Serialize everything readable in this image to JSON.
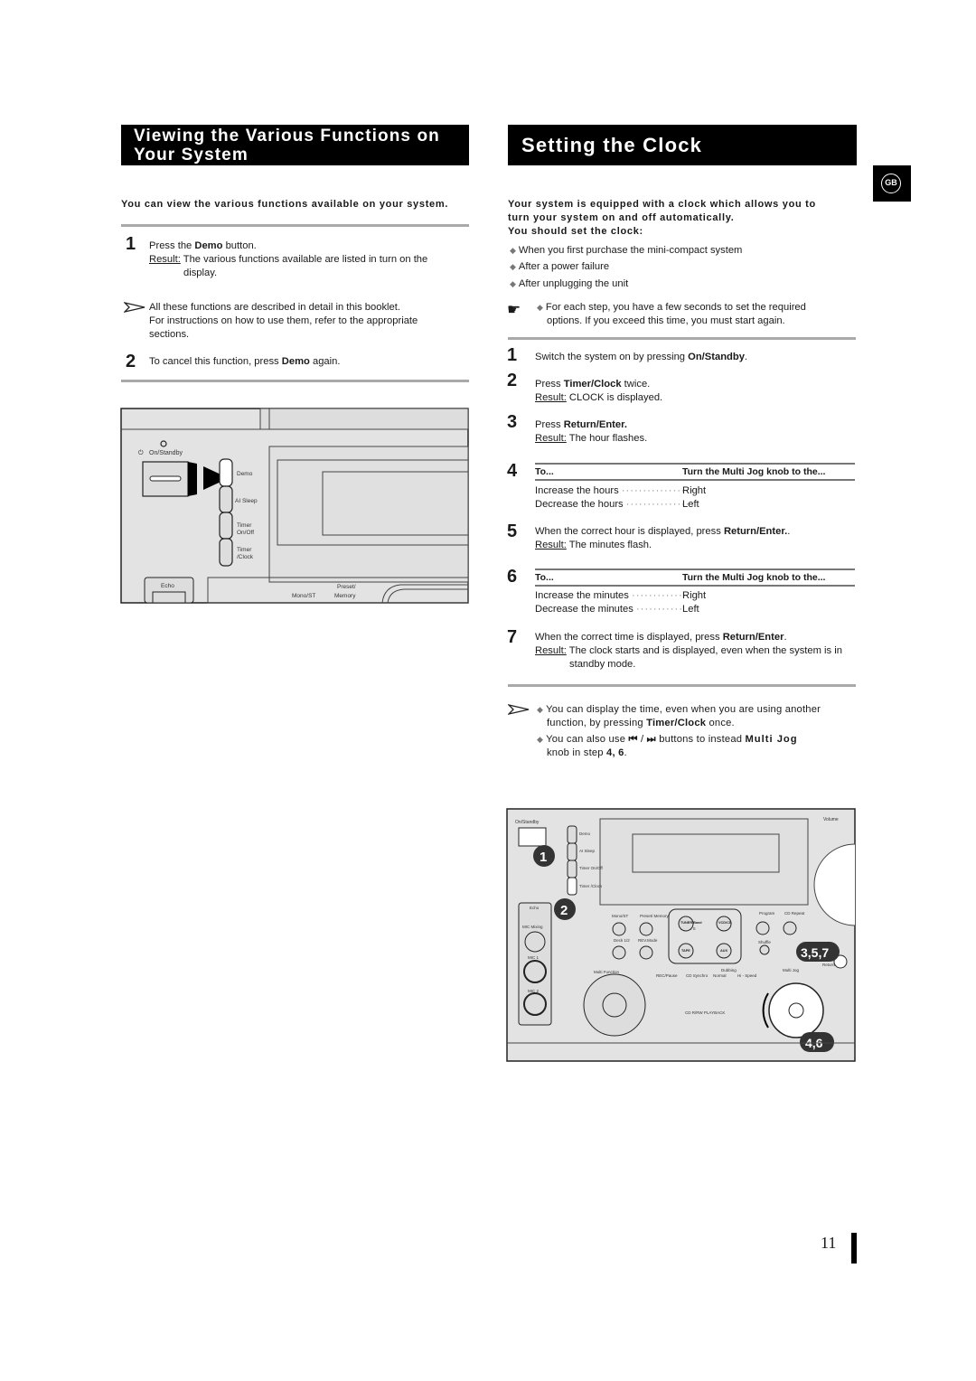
{
  "left": {
    "title_line1": "Viewing the Various Functions on",
    "title_line2": "Your System",
    "intro": "You can view the various functions available on your system.",
    "step1": {
      "num": "1",
      "pre": "Press the ",
      "bold": "Demo",
      "post": " button.",
      "result_label": "Result:",
      "result_text": " The various functions available are listed in turn on the",
      "result_cont": "display."
    },
    "note": {
      "line1": "All these functions are described in detail in this booklet.",
      "line2": "For instructions on how to use them, refer to the appropriate",
      "line3": "sections."
    },
    "step2": {
      "num": "2",
      "pre": "To cancel this function, press ",
      "bold": "Demo",
      "post": " again."
    },
    "figure": {
      "on_standby": "On/Standby",
      "demo": "Demo",
      "ai_sleep": "AI Sleep",
      "timer_onoff_1": "Timer",
      "timer_onoff_2": "On/Off",
      "timer_clock_1": "Timer",
      "timer_clock_2": "/Clock",
      "echo": "Echo",
      "mono_st": "Mono/ST",
      "preset_1": "Preset/",
      "preset_2": "Memory"
    }
  },
  "right": {
    "title": "Setting the Clock",
    "badge": "GB",
    "intro_line1": "Your system is equipped with a clock which allows you to",
    "intro_line2": "turn your system on and off automatically.",
    "intro_line3": "You should set the clock:",
    "bullets": [
      "When you first purchase the mini-compact system",
      "After a power failure",
      "After unplugging the unit"
    ],
    "hand_note": {
      "line1": "For each step, you have a few seconds to set the required",
      "line2": "options. If you exceed this time, you must start again."
    },
    "step1": {
      "num": "1",
      "pre": "Switch the system on by pressing ",
      "bold": "On/Standby",
      "post": "."
    },
    "step2": {
      "num": "2",
      "pre": "Press ",
      "bold": "Timer/Clock",
      "post": " twice.",
      "result_label": "Result:",
      "result_text": " CLOCK is displayed."
    },
    "step3": {
      "num": "3",
      "pre": "Press ",
      "bold": "Return/Enter.",
      "result_label": "Result:",
      "result_text": " The hour flashes."
    },
    "step4": {
      "num": "4",
      "col1": "To...",
      "col2": "Turn the Multi Jog knob to the...",
      "rows": [
        {
          "action": "Increase the hours",
          "dots": "··················",
          "dir": "Right"
        },
        {
          "action": "Decrease the hours",
          "dots": "················",
          "dir": "Left"
        }
      ]
    },
    "step5": {
      "num": "5",
      "pre": "When the correct hour is displayed, press ",
      "bold": "Return/Enter.",
      "post": ".",
      "result_label": "Result:",
      "result_text": " The minutes flash."
    },
    "step6": {
      "num": "6",
      "col1": "To...",
      "col2": "Turn the Multi Jog knob to the...",
      "rows": [
        {
          "action": "Increase the minutes",
          "dots": "·············",
          "dir": "Right"
        },
        {
          "action": "Decrease the minutes",
          "dots": "···········",
          "dir": "Left"
        }
      ]
    },
    "step7": {
      "num": "7",
      "pre": "When the correct time is displayed, press ",
      "bold": "Return/Enter",
      "post": ".",
      "result_label": "Result:",
      "result_text": " The clock starts and is displayed, even when the system is in",
      "result_cont": "standby mode."
    },
    "notes": {
      "n1_line1": "You can display the time, even when you are using another",
      "n1_pre": "function, by pressing ",
      "n1_bold": "Timer/Clock",
      "n1_post": " once.",
      "n2_pre": "You can also use ",
      "n2_prev": "⏮",
      "n2_sep": " / ",
      "n2_next": "⏭",
      "n2_mid": " buttons to instead ",
      "n2_bold": "Multi Jog",
      "n2_line2_pre": "knob in step ",
      "n2_steps": "4, 6",
      "n2_end": "."
    },
    "figure": {
      "callout_1": "1",
      "callout_2": "2",
      "callout_357": "3,5,7",
      "callout_46": "4,6",
      "volume": "Volume",
      "on_standby": "On/Standby",
      "demo": "Demo",
      "ai_sleep": "AI Sleep",
      "timer_onoff": "Timer On/Off",
      "timer_clock": "Timer /Clock",
      "echo": "Echo",
      "mic_mixing": "MIC Mixing",
      "mic1": "MIC 1",
      "mic2": "MIC 2",
      "mono_st": "Mono/ST",
      "preset": "Preset/ Memory",
      "tuner": "TUNER Band",
      "vcd": "VCD/CD",
      "dps": "D / P / S",
      "tape": "TAPE",
      "aux": "AUX",
      "program": "Program",
      "cd_repeat": "CD Repeat",
      "shuffle": "Shuffle",
      "deck": "Deck 1/2",
      "rev_mode": "REV.Mode",
      "rec_pause": "REC/Pause",
      "cd_synchro": "CD Synchro",
      "normal": "Normal",
      "hi_speed": "Hi - Speed",
      "dubbing": "Dubbing",
      "multi_function": "Multi Function",
      "prev": "PREV.",
      "next": "Next",
      "down": "Down",
      "up": "Up",
      "tuning_mode": "Tuning Mode",
      "playback": "CD R/RW PLAYBACK",
      "multi_jog": "Multi Jog",
      "return_enter": "Return/Enter"
    }
  },
  "page_number": "11"
}
